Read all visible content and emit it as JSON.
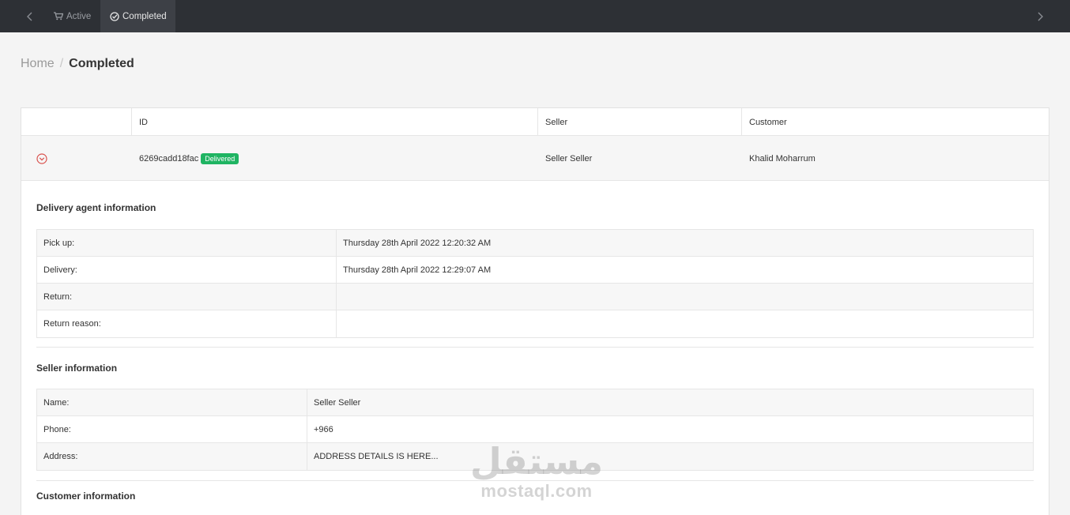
{
  "topbar": {
    "tabs": [
      {
        "label": "Active",
        "icon": "cart-icon"
      },
      {
        "label": "Completed",
        "icon": "check-circle-icon"
      }
    ]
  },
  "breadcrumb": {
    "home": "Home",
    "current": "Completed"
  },
  "orders_table": {
    "headers": {
      "id": "ID",
      "seller": "Seller",
      "customer": "Customer"
    },
    "row": {
      "id": "6269cadd18fac",
      "status": "Delivered",
      "seller": "Seller Seller",
      "customer": "Khalid Moharrum"
    }
  },
  "delivery_agent": {
    "title": "Delivery agent information",
    "rows": [
      {
        "label": "Pick up:",
        "value": "Thursday 28th April 2022 12:20:32 AM"
      },
      {
        "label": "Delivery:",
        "value": "Thursday 28th April 2022 12:29:07 AM"
      },
      {
        "label": "Return:",
        "value": ""
      },
      {
        "label": "Return reason:",
        "value": ""
      }
    ]
  },
  "seller_info": {
    "title": "Seller information",
    "rows": [
      {
        "label": "Name:",
        "value": "Seller Seller"
      },
      {
        "label": "Phone:",
        "value": "+966"
      },
      {
        "label": "Address:",
        "value": "ADDRESS DETAILS IS HERE..."
      }
    ]
  },
  "customer_info": {
    "title": "Customer information"
  },
  "watermark": {
    "arabic": "مستقل",
    "latin": "mostaql.com"
  },
  "colors": {
    "topbar": "#2d3035",
    "badge": "#1fb462",
    "expand_icon": "#d9534f"
  }
}
